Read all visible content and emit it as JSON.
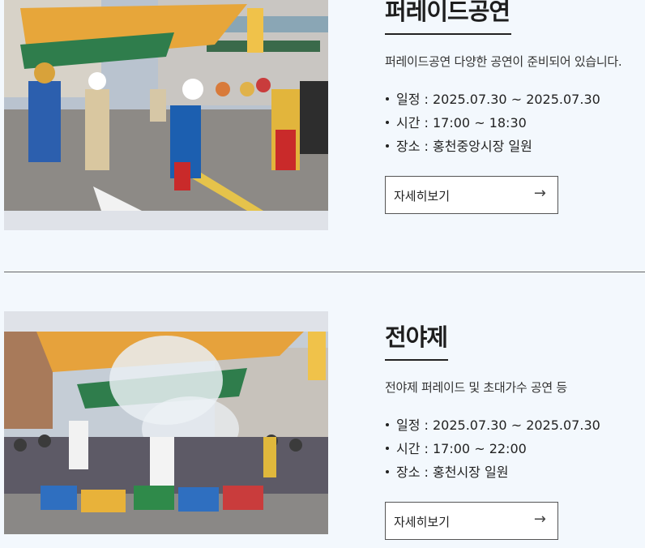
{
  "events": [
    {
      "title": "퍼레이드공연",
      "description": "퍼레이드공연 다양한 공연이 준비되어 있습니다.",
      "schedule": "일정 : 2025.07.30 ~ 2025.07.30",
      "time": "시간 : 17:00 ~ 18:30",
      "place": "장소 : 홍천중앙시장 일원",
      "button_label": "자세히보기",
      "button_icon": "arrow-right-icon"
    },
    {
      "title": "전야제",
      "description": "전야제 퍼레이드 및 초대가수 공연 등",
      "schedule": "일정 : 2025.07.30 ~ 2025.07.30",
      "time": "시간 : 17:00 ~ 22:00",
      "place": "장소 : 홍천시장 일원",
      "button_label": "자세히보기",
      "button_icon": "arrow-right-icon"
    }
  ],
  "colors": {
    "background": "#f3f8fd",
    "photo_frame": "#dfe2e8",
    "text": "#222222"
  }
}
